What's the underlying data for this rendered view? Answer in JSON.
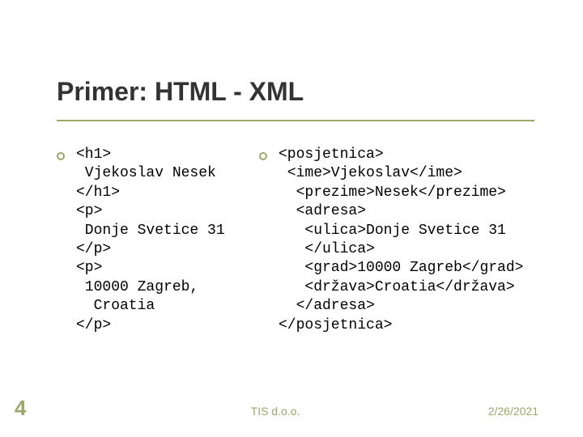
{
  "title": "Primer: HTML - XML",
  "left_code": "<h1>\n Vjekoslav Nesek\n</h1>\n<p>\n Donje Svetice 31\n</p>\n<p>\n 10000 Zagreb,\n  Croatia\n</p>",
  "right_code": "<posjetnica>\n <ime>Vjekoslav</ime>\n  <prezime>Nesek</prezime>\n  <adresa>\n   <ulica>Donje Svetice 31\n   </ulica>\n   <grad>10000 Zagreb</grad>\n   <država>Croatia</država>\n  </adresa>\n</posjetnica>",
  "footer": {
    "page_number": "4",
    "center": "TIS d.o.o.",
    "date": "2/26/2021"
  }
}
